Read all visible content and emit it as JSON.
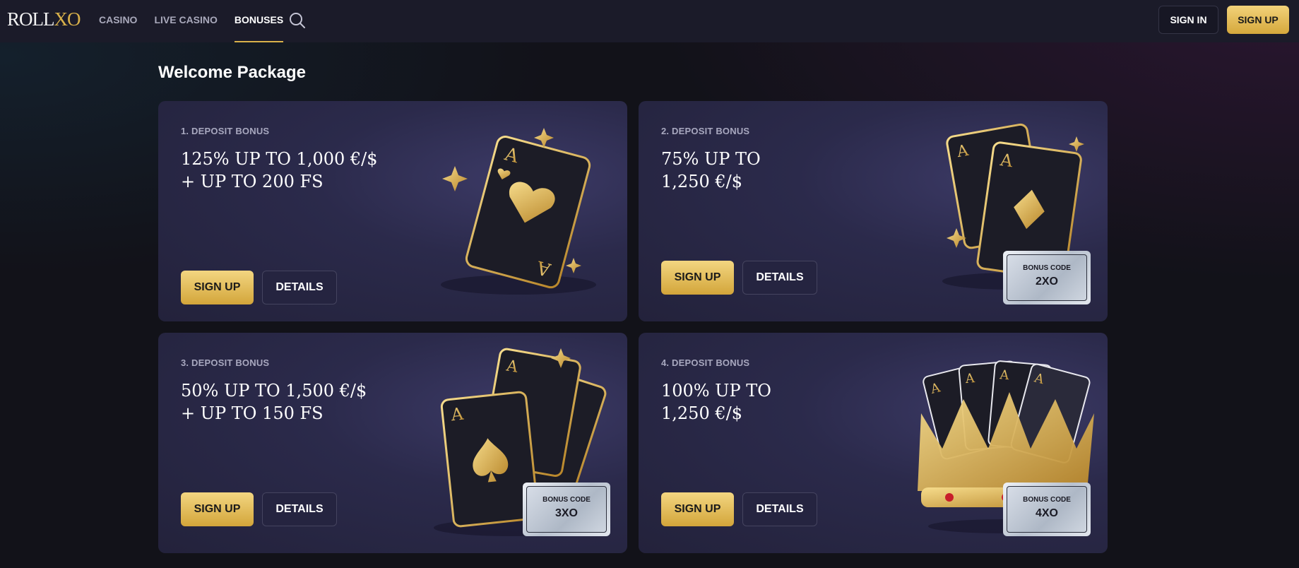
{
  "header": {
    "logo": {
      "roll": "ROLL",
      "xo": "XO"
    },
    "nav": [
      {
        "label": "CASINO",
        "active": false
      },
      {
        "label": "LIVE CASINO",
        "active": false
      },
      {
        "label": "BONUSES",
        "active": true
      }
    ],
    "sign_in_label": "SIGN IN",
    "sign_up_label": "SIGN UP"
  },
  "main": {
    "section_title": "Welcome Package",
    "cards": [
      {
        "label": "1. DEPOSIT BONUS",
        "title": "125% UP TO 1,000 €/$\n+ UP TO 200 FS",
        "sign_up": "SIGN UP",
        "details": "DETAILS",
        "bonus_code": null
      },
      {
        "label": "2. DEPOSIT BONUS",
        "title": "75% UP TO\n1,250 €/$",
        "sign_up": "SIGN UP",
        "details": "DETAILS",
        "bonus_code": {
          "label": "BONUS CODE",
          "value": "2XO"
        }
      },
      {
        "label": "3. DEPOSIT BONUS",
        "title": "50% UP TO 1,500 €/$\n+ UP TO 150 FS",
        "sign_up": "SIGN UP",
        "details": "DETAILS",
        "bonus_code": {
          "label": "BONUS CODE",
          "value": "3XO"
        }
      },
      {
        "label": "4. DEPOSIT BONUS",
        "title": "100% UP TO\n1,250 €/$",
        "sign_up": "SIGN UP",
        "details": "DETAILS",
        "bonus_code": {
          "label": "BONUS CODE",
          "value": "4XO"
        }
      }
    ]
  },
  "colors": {
    "accent_gold": "#d9b14a",
    "header_bg": "#1b1b29",
    "card_bg": "#2b2a4b",
    "page_bg": "#121219"
  },
  "icons": [
    "search-icon",
    "ace-of-hearts-icon",
    "ace-of-diamonds-icon",
    "ace-of-spades-icon",
    "crown-with-cards-icon",
    "sparkle-icon"
  ]
}
